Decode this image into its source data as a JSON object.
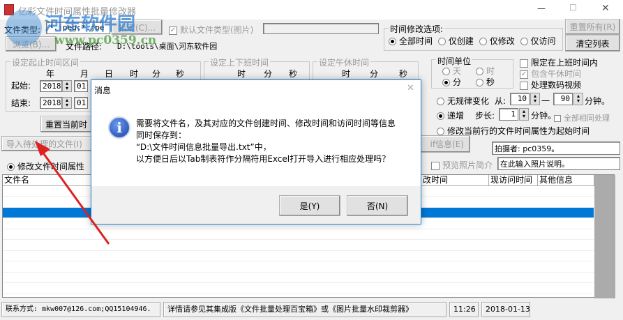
{
  "window": {
    "title": "亿彩文件时间属性批量修改器",
    "minimize": "—",
    "maximize": "☐",
    "close": "✕"
  },
  "watermark": {
    "name": "河东软件园",
    "url": "www.pc0359.cn"
  },
  "top": {
    "file_type_label": "文件类型:",
    "file_type_value": "*.jpeg;*.jpe",
    "specify_button": "指定(C)...",
    "default_type_label": "默认文件类型(图片)",
    "browse_button": "浏览(B)...",
    "file_path_label": "文件路径:",
    "file_path_value": "D:\\tools\\桌面\\河东软件园"
  },
  "range": {
    "legend": "设定起止时间区间",
    "cols": [
      "年",
      "月",
      "日",
      "时",
      "分",
      "秒"
    ],
    "start_label": "起始:",
    "end_label": "结束:",
    "start_year": "2018",
    "start_month": "01",
    "end_year": "2018",
    "end_month": "01",
    "reset_button": "重置当前时"
  },
  "work": {
    "legend": "设定上下班时间",
    "cols": [
      "时",
      "分",
      "秒"
    ]
  },
  "lunch": {
    "legend": "设定午休时间",
    "cols": [
      "时",
      "分",
      "秒"
    ]
  },
  "modify_options": {
    "legend": "时间修改选项:",
    "options": [
      "全部时间",
      "仅创建",
      "仅修改",
      "仅访问"
    ],
    "selected": 0
  },
  "reset_all_button": "重置所有(R)",
  "clear_list_button": "清空列表",
  "unit": {
    "legend": "时间单位",
    "options": [
      "天",
      "时",
      "分",
      "秒"
    ],
    "selected": 2
  },
  "checks": {
    "limit_work": "限定在上班时间内",
    "include_lunch": "包含午休时间",
    "process_video": "处理数码视频",
    "all_same": "全部相同处理",
    "preview_intro": "预览照片简介"
  },
  "mode": {
    "random_label": "无规律变化",
    "from_label": "从:",
    "from_value": "10",
    "dash": "一",
    "to_value": "90",
    "minutes": "分钟。",
    "increment_label": "递增",
    "step_label": "步长:",
    "step_value": "1",
    "current_row_label": "修改当前行的文件时间属性为起始时间"
  },
  "exif_button": "if信息(E)",
  "photographer_value": "拍摄者: pc0359。",
  "photo_desc_value": "在此输入照片说明。",
  "import_button": "导入待处理的文件(I)",
  "modify_attr_radio": "修改文件时间属性",
  "table": {
    "headers": [
      "文件名",
      "改时间",
      "现访问时间",
      "其他信息"
    ],
    "selected_row": 2
  },
  "status": {
    "contact": "联系方式: mkw007@126.com;QQ15104946.",
    "info": "详情请参见其集成版《文件批量处理百宝箱》或《图片批量水印裁剪器》",
    "time": "11:26",
    "date": "2018-01-13"
  },
  "dialog": {
    "title": "消息",
    "close": "✕",
    "lines": [
      "需要将文件名，及其对应的文件创建时间、修改时间和访问时间等信息",
      "同时保存到：",
      "“D:\\文件时间信息批量导出.txt”中，",
      "以方便日后以Tab制表符作分隔符用Excel打开导入进行相应处理吗？"
    ],
    "yes_button": "是(Y)",
    "no_button": "否(N)"
  },
  "colors": {
    "selection": "#0078d7",
    "arrow": "#e02020",
    "dialog_border": "#1883d7"
  }
}
